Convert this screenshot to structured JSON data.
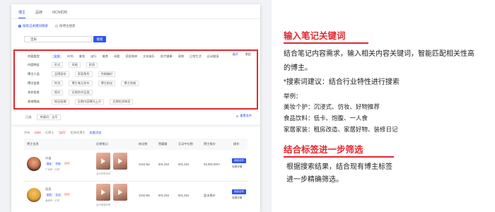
{
  "ui": {
    "tabs": [
      "博主",
      "品牌",
      "MCN机构"
    ],
    "mode_tabs": [
      "按笔记关键词搜索",
      "按博主搜索"
    ],
    "search": {
      "value": "洁乐",
      "button": "搜索"
    },
    "filter_rows": [
      {
        "label": "内容类型",
        "tags": [
          "全部",
          "时尚",
          "美妆",
          "出行",
          "美食",
          "母婴",
          "家居装修",
          "文化娱乐",
          "医疗健康",
          "宠物",
          "日常生活",
          "运动健身"
        ],
        "selected": 0
      },
      {
        "label": "内容特征",
        "tags": [
          "形式",
          "风格",
          "阶段"
        ]
      },
      {
        "label": "博主人设",
        "tags": [
          "品牌身份",
          "家庭角色",
          "性格偏好"
        ]
      },
      {
        "label": "博主信息",
        "tags": [
          "性别",
          "博主笔记发布",
          "博主粉丝",
          "博主地域"
        ]
      },
      {
        "label": "合作信息",
        "tags": [
          "报价",
          "近期合作品类"
        ]
      },
      {
        "label": "其他筛选",
        "tags": [
          "粉丝画像",
          "近期内容曝光上升",
          "近期优质商家"
        ]
      }
    ],
    "expand": "展开",
    "confirm": "收起",
    "selected": {
      "label": "已选",
      "chip": "关键词：洁乐"
    },
    "reset": "重置条件",
    "result": {
      "prefix": "共有",
      "count": "1234",
      "suffix": "位博主",
      "keyword": "\"洁乐\"",
      "note": "相关的博主",
      "link": "批量添加"
    },
    "table_headers": [
      "博主信息",
      "近期笔记",
      "粉丝数",
      "赞藏量",
      "互动中位数",
      "博主报价",
      "操作"
    ],
    "rows": [
      {
        "name": "小洁",
        "tags": [
          "美妆",
          "护肤",
          "Lv.3"
        ],
        "info": "广州市 · 24岁",
        "fans": "1044.8w",
        "likes": "601,254",
        "interact": "601,254",
        "price": "¥3,000,000+",
        "btn": "添加合作",
        "more": "查看详情",
        "cap": "洁乐护肤测评"
      },
      {
        "name": "乐乐",
        "tags": [
          "家居",
          "生活",
          "Lv.2"
        ],
        "info": "深圳市 · 27岁",
        "fans": "1044.8w",
        "likes": "601,254",
        "interact": "601,254",
        "price": "暂未报价",
        "btn": "添加合作",
        "more": "查看详情",
        "cap": "洁乐家居好物"
      }
    ]
  },
  "side": {
    "h1": "输入笔记关键词",
    "p1_line1": "结合笔记内容需求，输入相关内容关键词，智能匹配相关性高",
    "p1_line2": "的博主。",
    "tip": "*搜索词建议：结合行业特性进行搜索",
    "example_title": "举例：",
    "examples": [
      "美妆个护：沉浸式、仿妆、好物推荐",
      "食品饮料：低卡、饱腹、一人食",
      "家居家装：租房改造、家居好物、装修日记"
    ],
    "h2": "结合标签进一步筛选",
    "p2_line1": "根据搜索结果，结合现有博主标签",
    "p2_line2": "进一步精确筛选。"
  }
}
